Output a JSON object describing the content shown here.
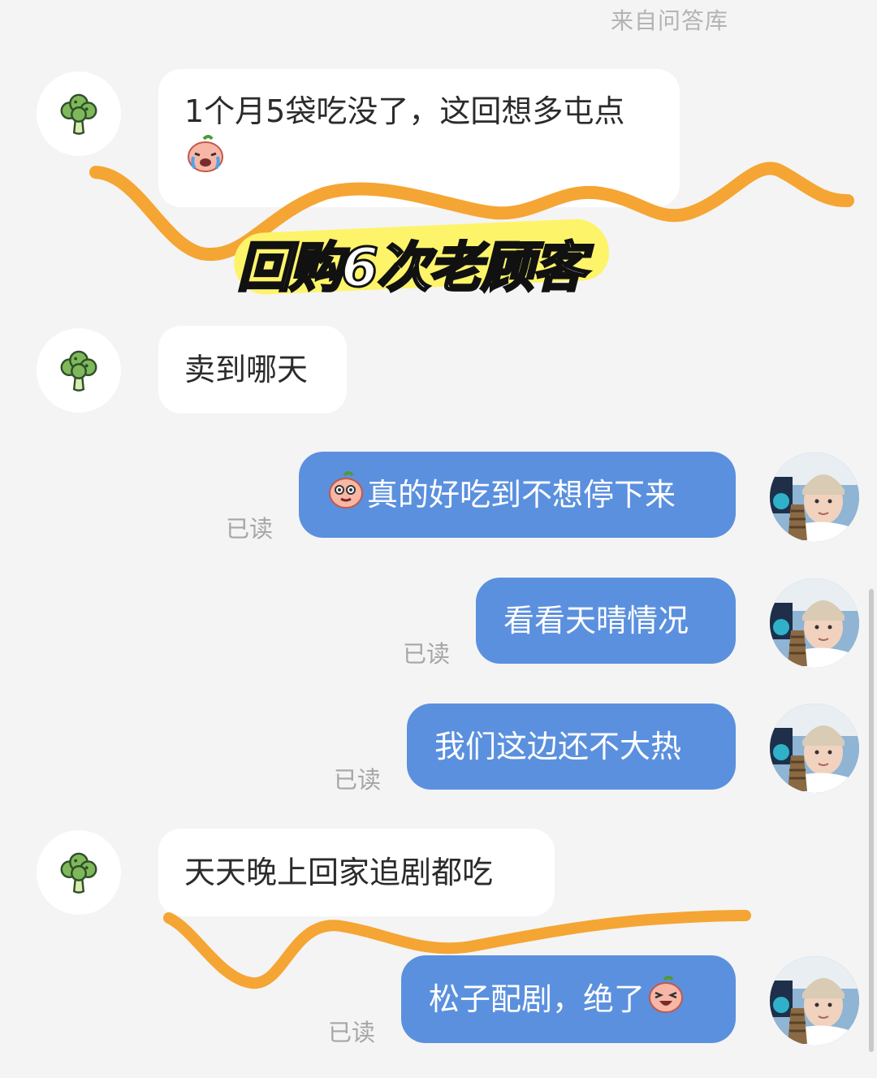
{
  "header": {
    "source_label": "来自问答库"
  },
  "overlay": {
    "caption": "回购6次老顾客"
  },
  "colors": {
    "outgoing_bubble": "#5b90de",
    "scribble": "#f5a533",
    "highlight": "#fdf46a"
  },
  "icons": {
    "customer_avatar": "broccoli-icon",
    "seller_avatar": "user-photo"
  },
  "messages": [
    {
      "direction": "incoming",
      "line1": "1个月5袋吃没了，这回想多屯点",
      "emoji": "crying-peach-emoji"
    },
    {
      "direction": "incoming",
      "text": "卖到哪天"
    },
    {
      "direction": "outgoing",
      "emoji": "peach-emoji",
      "text": "真的好吃到不想停下来",
      "status": "已读"
    },
    {
      "direction": "outgoing",
      "text": "看看天晴情况",
      "status": "已读"
    },
    {
      "direction": "outgoing",
      "text": "我们这边还不大热",
      "status": "已读"
    },
    {
      "direction": "incoming",
      "text": "天天晚上回家追剧都吃"
    },
    {
      "direction": "outgoing",
      "text": "松子配剧，绝了",
      "emoji": "laughing-peach-emoji",
      "status": "已读"
    }
  ]
}
